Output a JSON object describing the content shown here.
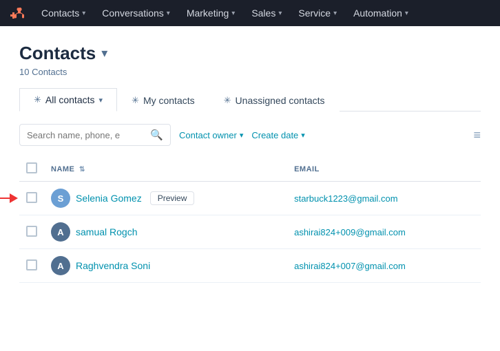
{
  "nav": {
    "logo_alt": "HubSpot",
    "items": [
      {
        "label": "Contacts",
        "has_caret": true
      },
      {
        "label": "Conversations",
        "has_caret": true
      },
      {
        "label": "Marketing",
        "has_caret": true
      },
      {
        "label": "Sales",
        "has_caret": true
      },
      {
        "label": "Service",
        "has_caret": true
      },
      {
        "label": "Automation",
        "has_caret": true
      }
    ]
  },
  "page": {
    "title": "Contacts",
    "subtitle": "10 Contacts"
  },
  "tabs": [
    {
      "label": "All contacts",
      "has_pin": true,
      "has_caret": true,
      "active": true
    },
    {
      "label": "My contacts",
      "has_pin": true,
      "has_caret": false,
      "active": false
    },
    {
      "label": "Unassigned contacts",
      "has_pin": true,
      "has_caret": false,
      "active": false
    }
  ],
  "toolbar": {
    "search_placeholder": "Search name, phone, e",
    "contact_owner_label": "Contact owner",
    "create_date_label": "Create date",
    "columns_icon": "≡"
  },
  "table": {
    "columns": [
      {
        "label": "NAME",
        "sortable": true
      },
      {
        "label": "EMAIL",
        "sortable": false
      }
    ],
    "rows": [
      {
        "avatar_letter": "S",
        "avatar_color": "#6B9FD4",
        "name": "Selenia Gomez",
        "email": "starbuck1223@gmail.com",
        "show_preview": true,
        "has_arrow": true
      },
      {
        "avatar_letter": "A",
        "avatar_color": "#516f90",
        "name": "samual Rogch",
        "email": "ashirai824+009@gmail.com",
        "show_preview": false,
        "has_arrow": false
      },
      {
        "avatar_letter": "A",
        "avatar_color": "#516f90",
        "name": "Raghvendra Soni",
        "email": "ashirai824+007@gmail.com",
        "show_preview": false,
        "has_arrow": false
      }
    ]
  }
}
